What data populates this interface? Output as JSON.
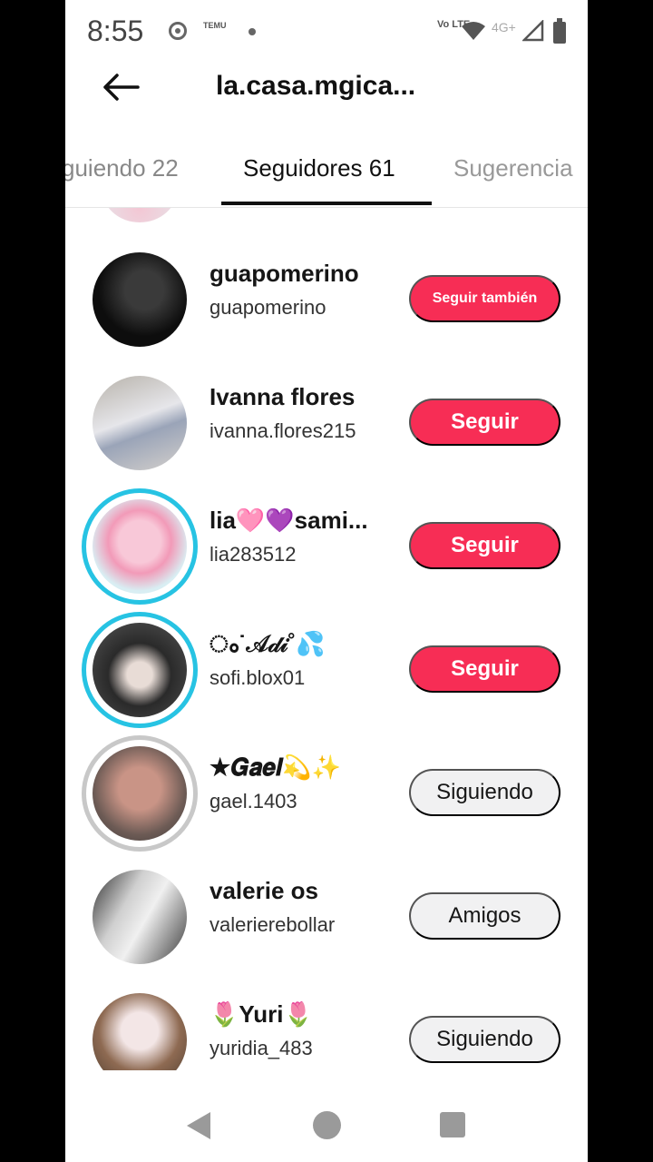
{
  "status_bar": {
    "time": "8:55",
    "temu_label": "TEMU",
    "volte_label": "Vo LTE",
    "network_label": "4G+"
  },
  "header": {
    "title": "la.casa.mgica..."
  },
  "tabs": [
    {
      "label": "guiendo 22"
    },
    {
      "label": "Seguidores 61"
    },
    {
      "label": "Sugerencia"
    }
  ],
  "users": [
    {
      "name": "guapomerino",
      "handle": "guapomerino",
      "button": "Seguir también",
      "button_style": "red"
    },
    {
      "name": "Ivanna flores",
      "handle": "ivanna.flores215",
      "button": "Seguir",
      "button_style": "red"
    },
    {
      "name": "lia🩷💜sami...",
      "handle": "lia283512",
      "button": "Seguir",
      "button_style": "red"
    },
    {
      "name": "ം˙𝒜𝒹𝒾˚💦",
      "handle": "sofi.blox01",
      "button": "Seguir",
      "button_style": "red"
    },
    {
      "name": "★𝑮𝒂𝒆𝒍💫✨",
      "handle": "gael.1403",
      "button": "Siguiendo",
      "button_style": "gray"
    },
    {
      "name": "valerie os",
      "handle": "valerierebollar",
      "button": "Amigos",
      "button_style": "gray"
    },
    {
      "name": "🌷Yuri🌷",
      "handle": "yuridia_483",
      "button": "Siguiendo",
      "button_style": "gray"
    }
  ],
  "colors": {
    "accent_red": "#f72d55",
    "story_ring": "#27c3e3"
  }
}
